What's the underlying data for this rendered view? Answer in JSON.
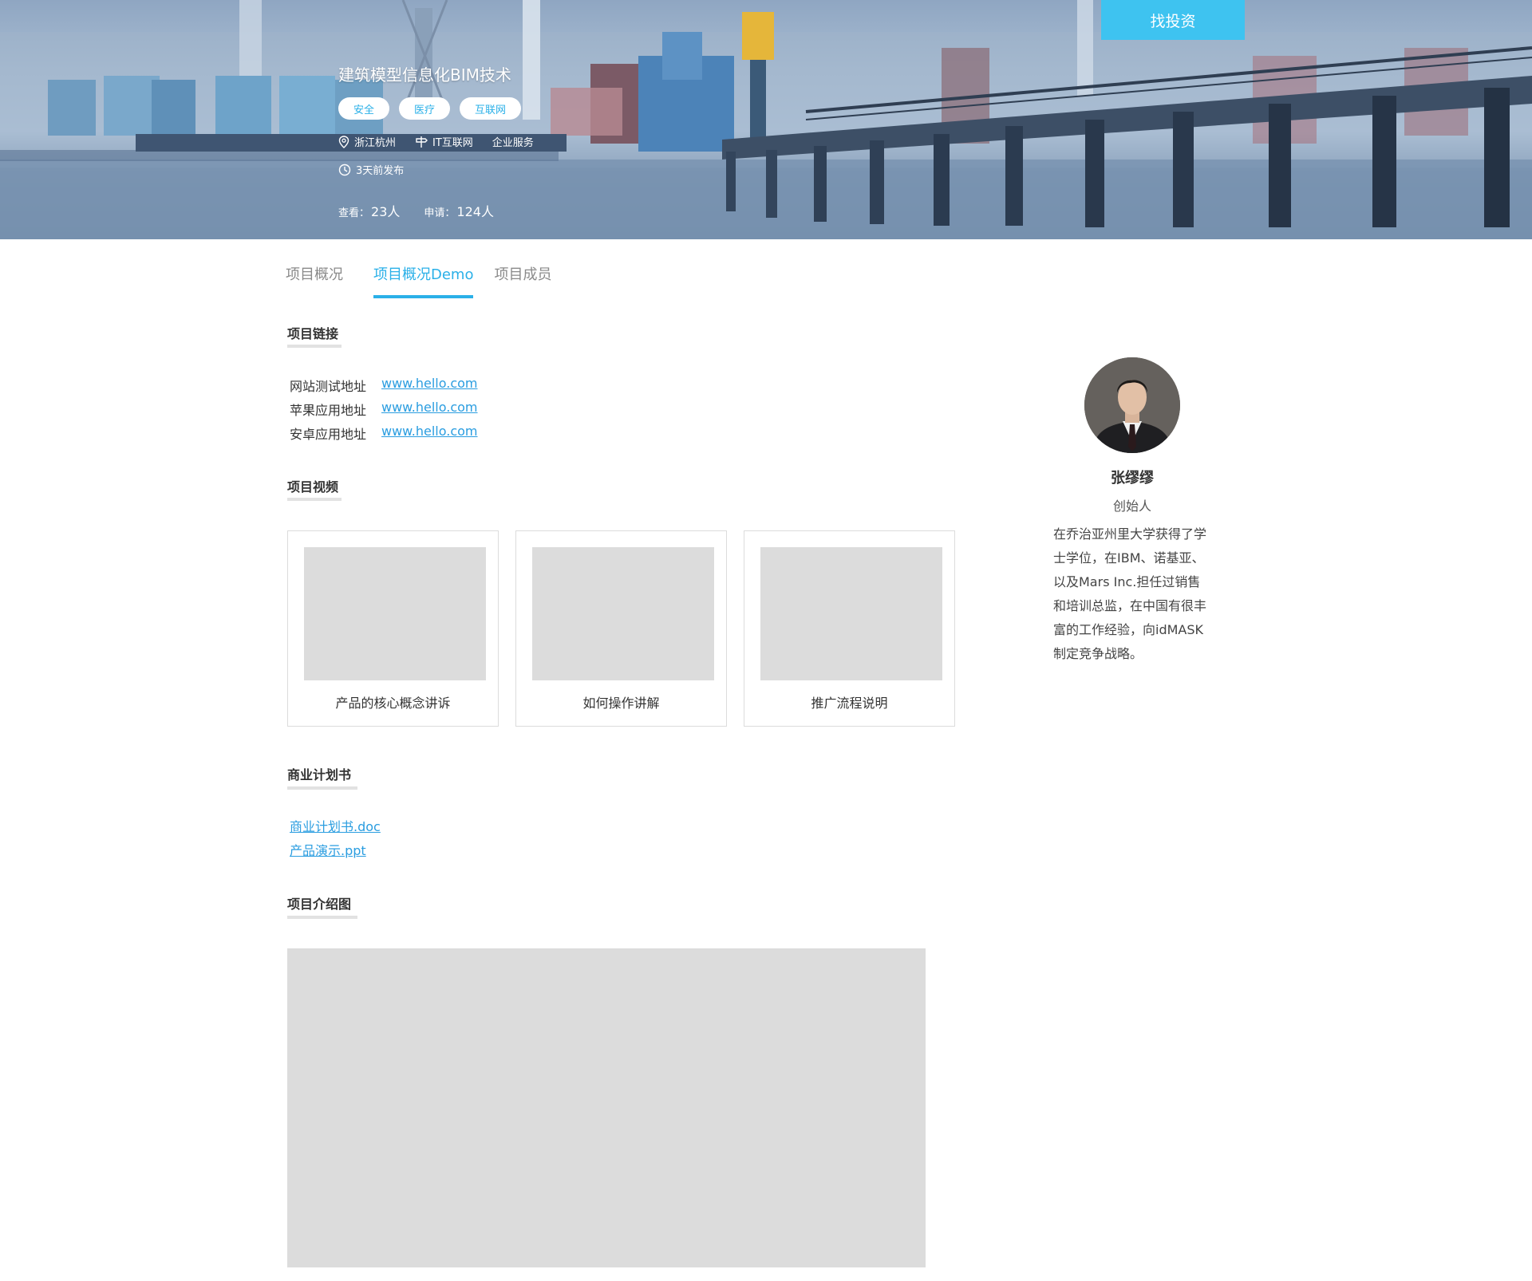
{
  "hero": {
    "cta_label": "找投资",
    "title": "建筑模型信息化BIM技术",
    "tags": [
      "安全",
      "医疗",
      "互联网"
    ],
    "location": "浙江杭州",
    "industry": "IT互联网",
    "category": "企业服务",
    "published": "3天前发布",
    "views_label": "查看：",
    "views_value": "23人",
    "applies_label": "申请：",
    "applies_value": "124人"
  },
  "tabs": [
    "项目概况",
    "项目概况Demo",
    "项目成员"
  ],
  "active_tab": "项目概况Demo",
  "links_section": {
    "title": "项目链接",
    "items": [
      {
        "label": "网站测试地址",
        "url": "www.hello.com"
      },
      {
        "label": "苹果应用地址",
        "url": "www.hello.com"
      },
      {
        "label": "安卓应用地址",
        "url": "www.hello.com"
      }
    ]
  },
  "video_section": {
    "title": "项目视频",
    "videos": [
      "产品的核心概念讲诉",
      "如何操作讲解",
      "推广流程说明"
    ]
  },
  "plan_section": {
    "title": "商业计划书",
    "files": [
      "商业计划书.doc",
      "产品演示.ppt"
    ]
  },
  "intro_section": {
    "title": "项目介绍图"
  },
  "founder": {
    "name": "张缪缪",
    "role": "创始人",
    "bio_lines": [
      "在乔治亚州里大学获得了学",
      "士学位，在IBM、诺基亚、",
      "以及Mars Inc.担任过销售",
      "和培训总监，在中国有很丰",
      "富的工作经验，向idMASK",
      "制定竞争战略。"
    ]
  },
  "colors": {
    "accent": "#2ab0e8",
    "cta": "#3ec3f0",
    "link": "#2a9de0",
    "placeholder": "#dcdcdc"
  }
}
